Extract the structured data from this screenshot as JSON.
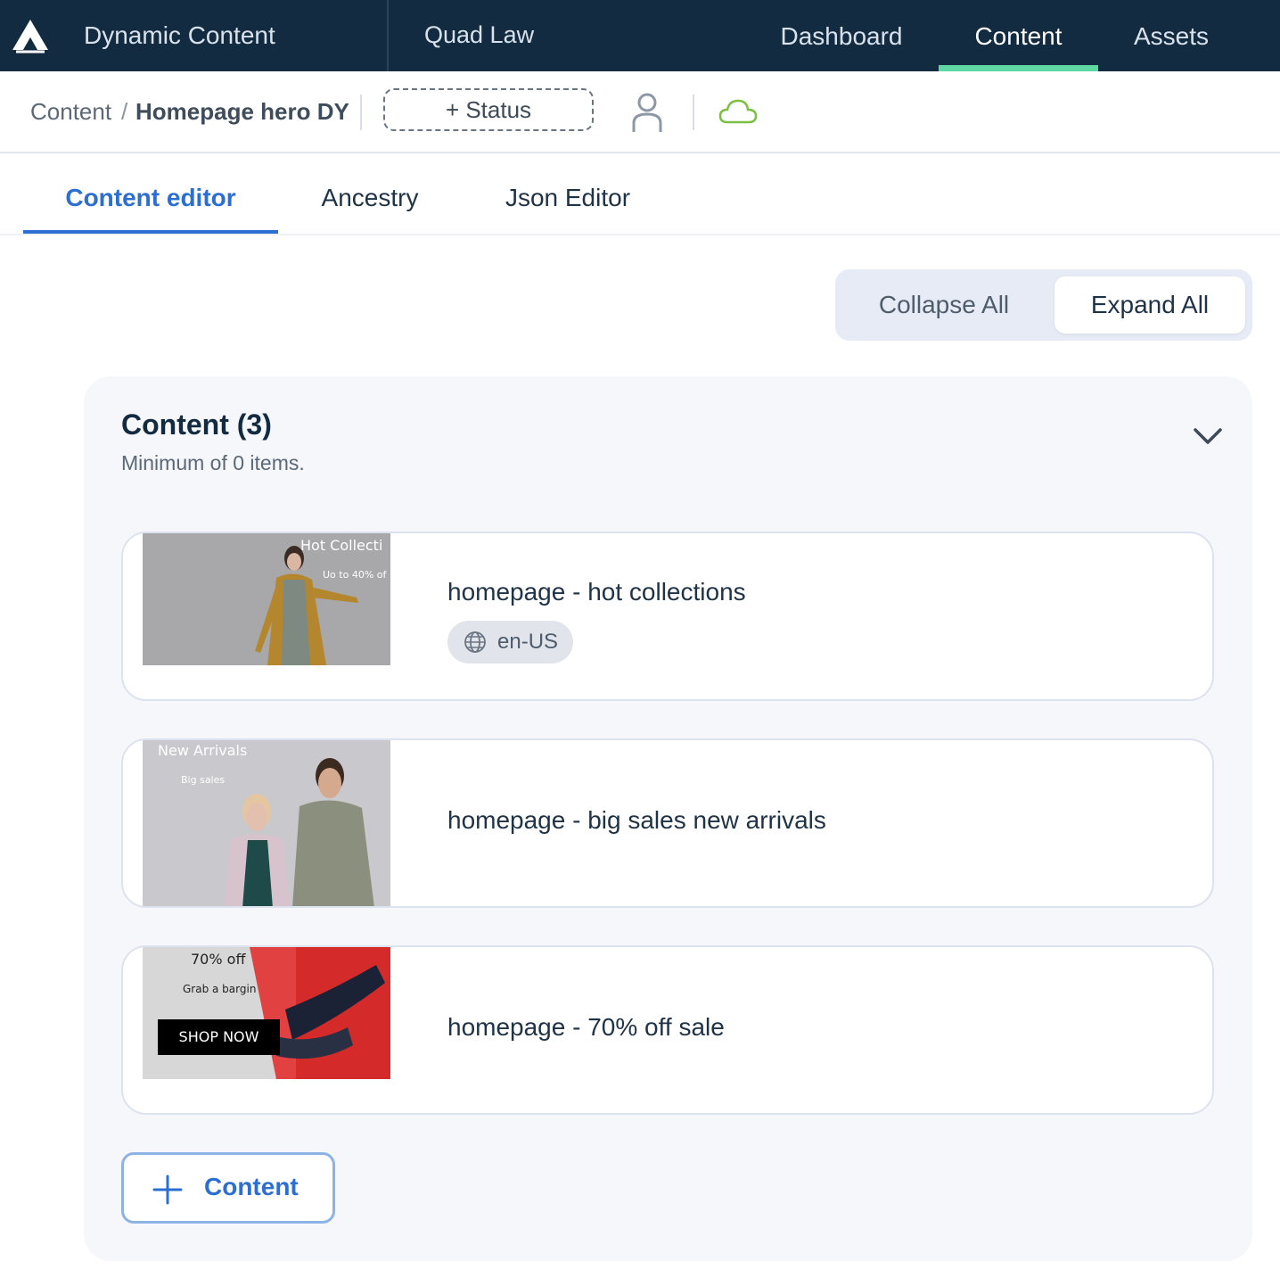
{
  "topbar": {
    "app_title": "Dynamic Content",
    "hub_name": "Quad Law",
    "nav": [
      {
        "label": "Dashboard",
        "active": false
      },
      {
        "label": "Content",
        "active": true
      },
      {
        "label": "Assets",
        "active": false
      }
    ],
    "accent_color": "#5fd7a2",
    "background_color": "#122b40"
  },
  "breadcrumb": {
    "root": "Content",
    "separator": "/",
    "current": "Homepage hero DY"
  },
  "toolbar": {
    "status_label": "+ Status",
    "user_icon": "user-icon",
    "cloud_icon": "cloud-icon",
    "cloud_color": "#7bc043"
  },
  "tabs": [
    {
      "label": "Content editor",
      "active": true
    },
    {
      "label": "Ancestry",
      "active": false
    },
    {
      "label": "Json Editor",
      "active": false
    }
  ],
  "toggle": {
    "collapse_label": "Collapse All",
    "expand_label": "Expand All",
    "selected": "Expand All"
  },
  "content_panel": {
    "title": "Content (3)",
    "subtitle": "Minimum of 0 items.",
    "items": [
      {
        "label": "homepage - hot collections",
        "locale": "en-US",
        "thumbnail": {
          "headline": "Hot Collecti",
          "subline": "Uo to 40% of"
        }
      },
      {
        "label": "homepage - big sales new arrivals",
        "thumbnail": {
          "headline": "New Arrivals",
          "subline": "Big sales"
        }
      },
      {
        "label": "homepage - 70% off sale",
        "thumbnail": {
          "headline": "70% off",
          "subline": "Grab a bargin",
          "button": "SHOP NOW"
        }
      }
    ],
    "add_button_label": "Content"
  }
}
